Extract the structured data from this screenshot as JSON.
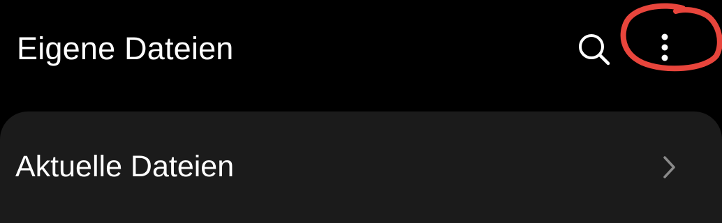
{
  "app_bar": {
    "title": "Eigene Dateien",
    "actions": [
      {
        "icon": "search-icon"
      },
      {
        "icon": "more-vertical-icon"
      }
    ]
  },
  "list": {
    "items": [
      {
        "label": "Aktuelle Dateien",
        "icon": "chevron-right-icon"
      }
    ]
  },
  "colors": {
    "background": "#000000",
    "card": "#1b1b1b",
    "text": "#ffffff",
    "chevron": "#8a8a8a",
    "annotation": "#e8453c"
  }
}
